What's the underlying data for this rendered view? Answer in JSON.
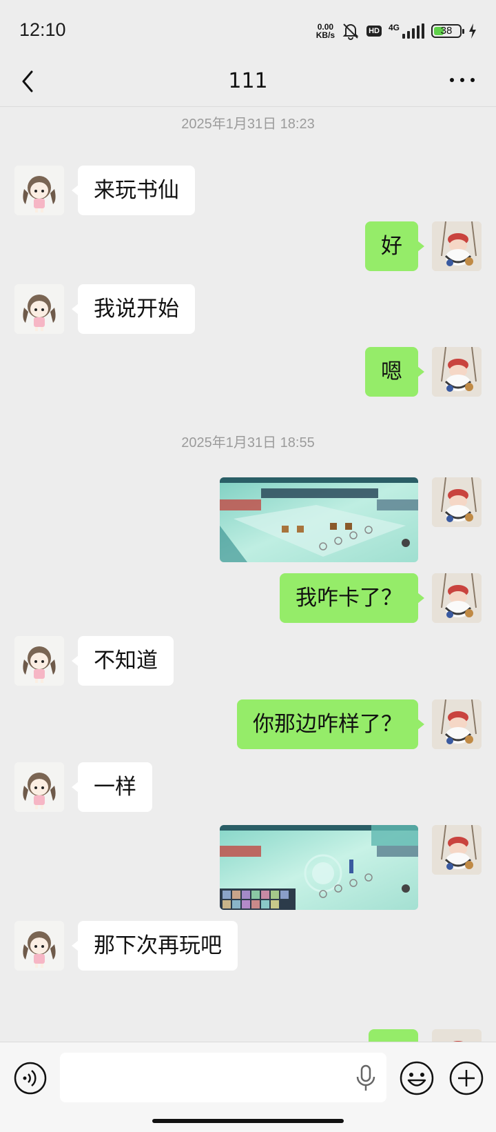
{
  "status_bar": {
    "time": "12:10",
    "net_speed_value": "0.00",
    "net_speed_unit": "KB/s",
    "hd_label": "HD",
    "network_label": "4G",
    "battery_level": "38"
  },
  "header": {
    "title": "111"
  },
  "chat": {
    "timestamps": [
      "2025年1月31日 18:23",
      "2025年1月31日 18:55"
    ],
    "messages": [
      {
        "side": "left",
        "type": "text",
        "text": "来玩书仙"
      },
      {
        "side": "right",
        "type": "text",
        "text": "好"
      },
      {
        "side": "left",
        "type": "text",
        "text": "我说开始"
      },
      {
        "side": "right",
        "type": "text",
        "text": "嗯"
      },
      {
        "side": "right",
        "type": "image",
        "description": "game-screenshot"
      },
      {
        "side": "right",
        "type": "text",
        "text": "我咋卡了？"
      },
      {
        "side": "left",
        "type": "text",
        "text": "不知道"
      },
      {
        "side": "right",
        "type": "text",
        "text": "你那边咋样了？"
      },
      {
        "side": "left",
        "type": "text",
        "text": "一样"
      },
      {
        "side": "right",
        "type": "image",
        "description": "game-screenshot"
      },
      {
        "side": "left",
        "type": "text",
        "text": "那下次再玩吧"
      },
      {
        "side": "right",
        "type": "text",
        "text": ""
      }
    ]
  },
  "input_bar": {
    "icons": [
      "voice-icon",
      "mic-icon",
      "emoji-icon",
      "plus-icon"
    ]
  },
  "colors": {
    "background": "#ededed",
    "outgoing_bubble": "#95ec69",
    "incoming_bubble": "#ffffff",
    "timestamp_text": "#9b9b9b"
  }
}
